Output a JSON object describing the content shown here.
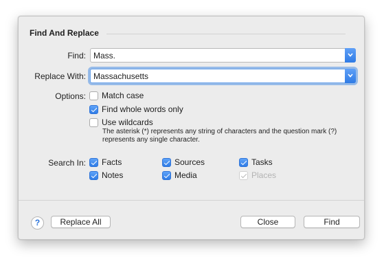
{
  "dialog": {
    "title": "Find And Replace",
    "find_label": "Find:",
    "find_value": "Mass.",
    "replace_label": "Replace With:",
    "replace_value": "Massachusetts",
    "options_label": "Options:",
    "options": {
      "match_case": {
        "label": "Match case",
        "checked": false
      },
      "whole_words": {
        "label": "Find whole words only",
        "checked": true
      },
      "wildcards": {
        "label": "Use wildcards",
        "checked": false
      }
    },
    "wildcard_note": "The asterisk (*) represents any string of characters and the question mark (?) represents any single character.",
    "search_in_label": "Search In:",
    "search_in": {
      "facts": {
        "label": "Facts",
        "checked": true
      },
      "sources": {
        "label": "Sources",
        "checked": true
      },
      "tasks": {
        "label": "Tasks",
        "checked": true
      },
      "notes": {
        "label": "Notes",
        "checked": true
      },
      "media": {
        "label": "Media",
        "checked": true
      },
      "places": {
        "label": "Places",
        "checked": true,
        "disabled": true
      }
    },
    "help_symbol": "?",
    "replace_all_label": "Replace All",
    "close_label": "Close",
    "find_button_label": "Find"
  },
  "colors": {
    "accent": "#3b86f0",
    "dialog_bg": "#ececec"
  }
}
